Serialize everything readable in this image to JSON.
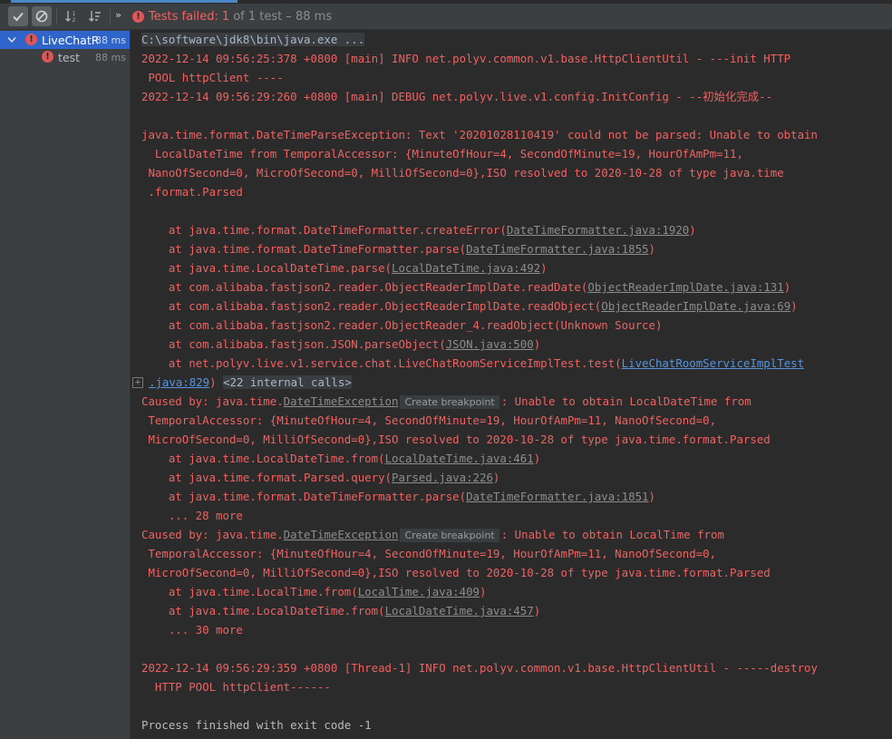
{
  "toolbar": {
    "chevron": "»",
    "status_label": "Tests failed:",
    "failed_count": "1",
    "status_rest": "of 1 test – 88 ms"
  },
  "tree": {
    "root": {
      "label": "LiveChatRc",
      "time": "88 ms"
    },
    "child": {
      "label": "test",
      "time": "88 ms"
    }
  },
  "console": {
    "cmd": "C:\\software\\jdk8\\bin\\java.exe ...",
    "l1a": "2022-12-14 09:56:25:378 +0800 [main] INFO net.polyv.common.v1.base.HttpClientUtil - ---init HTTP",
    "l1b": " POOL httpClient ----",
    "l2": "2022-12-14 09:56:29:260 +0800 [main] DEBUG net.polyv.live.v1.config.InitConfig - --初始化完成--",
    "ex1": "java.time.format.DateTimeParseException: Text '20201028110419' could not be parsed: Unable to obtain",
    "ex2": "  LocalDateTime from TemporalAccessor: {MinuteOfHour=4, SecondOfMinute=19, HourOfAmPm=11,",
    "ex3": " NanoOfSecond=0, MicroOfSecond=0, MilliOfSecond=0},ISO resolved to 2020-10-28 of type java.time",
    "ex4": " .format.Parsed",
    "frames": [
      {
        "pre": "    at java.time.format.DateTimeFormatter.createError(",
        "link": "DateTimeFormatter.java:1920",
        "post": ")"
      },
      {
        "pre": "    at java.time.format.DateTimeFormatter.parse(",
        "link": "DateTimeFormatter.java:1855",
        "post": ")"
      },
      {
        "pre": "    at java.time.LocalDateTime.parse(",
        "link": "LocalDateTime.java:492",
        "post": ")"
      },
      {
        "pre": "    at com.alibaba.fastjson2.reader.ObjectReaderImplDate.readDate(",
        "link": "ObjectReaderImplDate.java:131",
        "post": ")"
      },
      {
        "pre": "    at com.alibaba.fastjson2.reader.ObjectReaderImplDate.readObject(",
        "link": "ObjectReaderImplDate.java:69",
        "post": ")"
      },
      {
        "pre": "    at com.alibaba.fastjson2.reader.ObjectReader_4.readObject(Unknown Source)",
        "link": "",
        "post": ""
      },
      {
        "pre": "    at com.alibaba.fastjson.JSON.parseObject(",
        "link": "JSON.java:500",
        "post": ")"
      }
    ],
    "test_frame_pre": "    at net.polyv.live.v1.service.chat.LiveChatRoomServiceImplTest.test(",
    "test_frame_link": "LiveChatRoomServiceImplTest",
    "test_frame_link2": ".java:829",
    "test_frame_post": ")",
    "internal_calls": "<22 internal calls>",
    "fold_icon": "+",
    "caused1": {
      "pre": "Caused by: java.time.",
      "cls": "DateTimeException",
      "chip": "Create breakpoint",
      "post": ": Unable to obtain LocalDateTime from",
      "l2": " TemporalAccessor: {MinuteOfHour=4, SecondOfMinute=19, HourOfAmPm=11, NanoOfSecond=0,",
      "l3": " MicroOfSecond=0, MilliOfSecond=0},ISO resolved to 2020-10-28 of type java.time.format.Parsed",
      "frames": [
        {
          "pre": "    at java.time.LocalDateTime.from(",
          "link": "LocalDateTime.java:461",
          "post": ")"
        },
        {
          "pre": "    at java.time.format.Parsed.query(",
          "link": "Parsed.java:226",
          "post": ")"
        },
        {
          "pre": "    at java.time.format.DateTimeFormatter.parse(",
          "link": "DateTimeFormatter.java:1851",
          "post": ")"
        }
      ],
      "more": "    ... 28 more"
    },
    "caused2": {
      "pre": "Caused by: java.time.",
      "cls": "DateTimeException",
      "chip": "Create breakpoint",
      "post": ": Unable to obtain LocalTime from",
      "l2": " TemporalAccessor: {MinuteOfHour=4, SecondOfMinute=19, HourOfAmPm=11, NanoOfSecond=0,",
      "l3": " MicroOfSecond=0, MilliOfSecond=0},ISO resolved to 2020-10-28 of type java.time.format.Parsed",
      "frames": [
        {
          "pre": "    at java.time.LocalTime.from(",
          "link": "LocalTime.java:409",
          "post": ")"
        },
        {
          "pre": "    at java.time.LocalDateTime.from(",
          "link": "LocalDateTime.java:457",
          "post": ")"
        }
      ],
      "more": "    ... 30 more"
    },
    "destroy1": "2022-12-14 09:56:29:359 +0800 [Thread-1] INFO net.polyv.common.v1.base.HttpClientUtil - -----destroy",
    "destroy2": "  HTTP POOL httpClient------",
    "exit": "Process finished with exit code -1"
  },
  "colors": {
    "error": "#ef6262",
    "link": "#5894df",
    "selection": "#2f65ca"
  },
  "icons": [
    "check-icon",
    "cancel-icon",
    "sort-alpha-icon",
    "sort-duration-icon",
    "error-icon",
    "chevron-down-icon",
    "expand-icon"
  ]
}
